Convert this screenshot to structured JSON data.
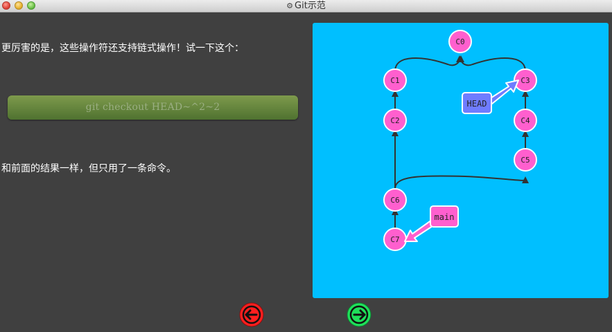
{
  "window": {
    "title": "Git示范"
  },
  "text": {
    "intro": "更厉害的是，这些操作符还支持链式操作！试一下这个：",
    "command": "git checkout HEAD~^2~2",
    "result": "和前面的结果一样，但只用了一条命令。"
  },
  "graph": {
    "commits": [
      "C0",
      "C1",
      "C2",
      "C3",
      "C4",
      "C5",
      "C6",
      "C7"
    ],
    "refs": {
      "head": "HEAD",
      "branch": "main"
    }
  },
  "colors": {
    "background": "#404040",
    "viz_background": "#00bfff",
    "commit": "#ff5fce",
    "head_ref": "#6f7cff",
    "branch_ref": "#ff5fce",
    "command_button": "#6a8a3e",
    "prev_button": "#ff1f1f",
    "next_button": "#1fe05a"
  },
  "navigation": {
    "prev_icon": "arrow-left-icon",
    "next_icon": "arrow-right-icon"
  }
}
